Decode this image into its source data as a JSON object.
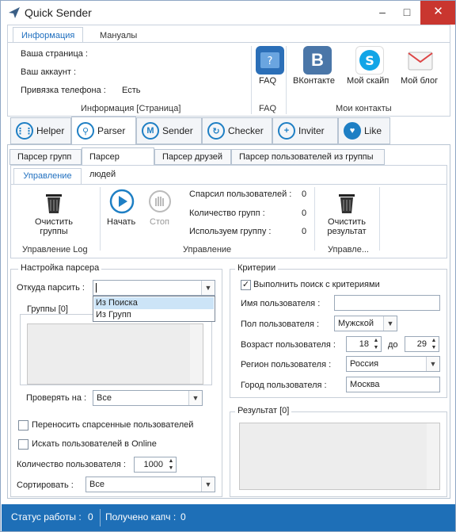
{
  "app": {
    "title": "Quick Sender"
  },
  "window_controls": {
    "minimize": "–",
    "maximize": "□",
    "close": "✕"
  },
  "ribbon": {
    "tabs": [
      "Информация",
      "Мануалы"
    ],
    "info_rows": [
      {
        "label": "Ваша страница :",
        "value": ""
      },
      {
        "label": "Ваш аккаунт :",
        "value": ""
      },
      {
        "label": "Привязка телефона :",
        "value": "Есть"
      }
    ],
    "info_caption": "Информация [Страница]",
    "faq": {
      "label": "FAQ",
      "caption": "FAQ"
    },
    "contacts": [
      {
        "label": "ВКонтакте",
        "icon": "vk-icon"
      },
      {
        "label": "Мой скайп",
        "icon": "skype-icon"
      },
      {
        "label": "Мой блог",
        "icon": "mail-icon"
      }
    ],
    "contacts_caption": "Мои контакты"
  },
  "main_tabs": [
    "Helper",
    "Parser",
    "Sender",
    "Checker",
    "Inviter",
    "Like"
  ],
  "sub_tabs": [
    "Парсер групп",
    "Парсер людей",
    "Парсер друзей",
    "Парсер пользователей из группы"
  ],
  "control_tab": "Управление",
  "control": {
    "clear_log": "Очистить группы",
    "log_caption": "Управление Log",
    "start": "Начать",
    "stop": "Стоп",
    "stats": [
      {
        "label": "Спарсил пользователей :",
        "value": "0"
      },
      {
        "label": "Количество групп :",
        "value": "0"
      },
      {
        "label": "Используем группу :",
        "value": "0"
      }
    ],
    "control_caption": "Управление",
    "clear_result": "Очистить результат",
    "result_caption": "Управле..."
  },
  "settings": {
    "title": "Настройка парсера",
    "source_label": "Откуда парсить :",
    "source_value": "",
    "source_options": [
      "Из Поиска",
      "Из Групп"
    ],
    "groups_title": "Группы [0]",
    "check_on_label": "Проверять на :",
    "check_on_value": "Все",
    "transfer_label": "Переносить спарсенные пользователей",
    "online_label": "Искать пользователей в Online",
    "count_label": "Количество пользователя :",
    "count_value": "1000",
    "sort_label": "Сортировать :",
    "sort_value": "Все"
  },
  "criteria": {
    "title": "Критерии",
    "use_label": "Выполнить поиск с критериями",
    "use_checked": true,
    "name_label": "Имя пользователя :",
    "name_value": "",
    "gender_label": "Пол пользователя :",
    "gender_value": "Мужской",
    "age_label": "Возраст пользователя :",
    "age_from": "18",
    "age_to_label": "до",
    "age_to": "29",
    "region_label": "Регион пользователя :",
    "region_value": "Россия",
    "city_label": "Город пользователя :",
    "city_value": "Москва"
  },
  "result": {
    "title": "Результат [0]"
  },
  "status": {
    "work_label": "Статус работы :",
    "work_value": "0",
    "captcha_label": "Получено капч :",
    "captcha_value": "0"
  }
}
